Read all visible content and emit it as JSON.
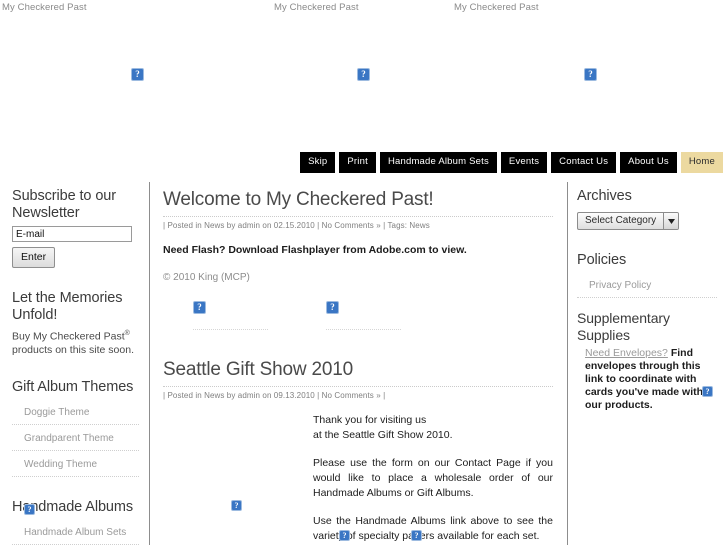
{
  "page": {
    "site_title": "My Checkered Past",
    "alt_texts": [
      "My Checkered Past",
      "My Checkered Past",
      "My Checkered Past"
    ]
  },
  "nav": {
    "items": [
      {
        "label": "Skip",
        "current": false
      },
      {
        "label": "Print",
        "current": false
      },
      {
        "label": "Handmade Album Sets",
        "current": false
      },
      {
        "label": "Events",
        "current": false
      },
      {
        "label": "Contact Us",
        "current": false
      },
      {
        "label": "About Us",
        "current": false
      },
      {
        "label": "Home",
        "current": true
      }
    ],
    "current_color": "#ecd9a0",
    "bg_color": "#000000"
  },
  "sidebar_left": {
    "newsletter": {
      "title": "Subscribe to our Newsletter",
      "input_value": "E-mail",
      "input_placeholder": "E-mail",
      "button_label": "Enter"
    },
    "memories": {
      "title": "Let the Memories Unfold!",
      "text_before": "Buy My Checkered Past",
      "text_sup": "®",
      "text_after": " products on this site soon."
    },
    "gift_themes": {
      "title": "Gift Album Themes",
      "items": [
        "Doggie Theme",
        "Grandparent Theme",
        "Wedding Theme"
      ]
    },
    "handmade": {
      "title": "Handmade Albums",
      "items": [
        "Handmade Album Sets"
      ]
    }
  },
  "main": {
    "posts": [
      {
        "title": "Welcome to My Checkered Past!",
        "meta": "| Posted in News by admin on 02.15.2010 | No Comments » | Tags:  News",
        "body": "Need Flash? Download Flashplayer from Adobe.com to view.",
        "copyright": "© 2010 King (MCP)"
      },
      {
        "title": "Seattle Gift Show 2010",
        "meta": "| Posted in News by admin on 09.13.2010 | No Comments » |",
        "paragraphs": [
          "Thank you for visiting us\nat the Seattle Gift Show 2010.",
          "Please use the form on our Contact Page if you would like to place a wholesale order of our Handmade Albums or Gift Albums.",
          "Use the Handmade Albums link above to see the variety of specialty papers available for each set."
        ]
      }
    ]
  },
  "sidebar_right": {
    "archives": {
      "title": "Archives",
      "select_value": "Select Category"
    },
    "policies": {
      "title": "Policies",
      "items": [
        "Privacy Policy"
      ]
    },
    "supplies": {
      "title": "Supplementary Supplies",
      "link_text": "Need Envelopes?",
      "body_text": " Find envelopes through this link to coordinate with cards you've made with our products."
    }
  },
  "placeholders": {
    "icon_name": "broken-image-icon",
    "glyph": "?"
  }
}
